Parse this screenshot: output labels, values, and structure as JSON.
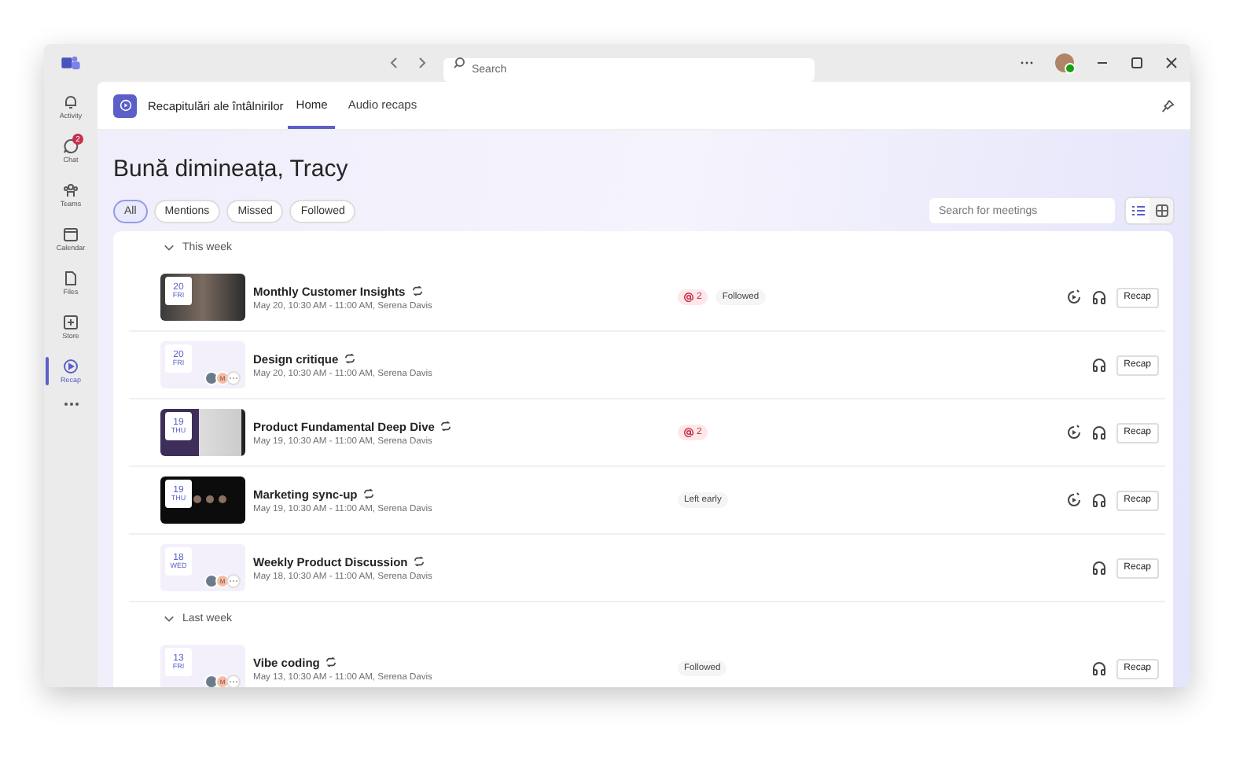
{
  "titlebar": {
    "search_placeholder": "Search"
  },
  "rail": [
    {
      "label": "Activity",
      "kind": "bell",
      "selected": false
    },
    {
      "label": "Chat",
      "kind": "chat",
      "selected": false,
      "badge": "2"
    },
    {
      "label": "Teams",
      "kind": "teams",
      "selected": false
    },
    {
      "label": "Calendar",
      "kind": "calendar",
      "selected": false
    },
    {
      "label": "Files",
      "kind": "file",
      "selected": false
    },
    {
      "label": "Store",
      "kind": "store",
      "selected": false
    },
    {
      "label": "Recap",
      "kind": "recap",
      "selected": true
    }
  ],
  "app": {
    "title": "Recapitulări ale întâlnirilor",
    "tabs": [
      {
        "label": "Home",
        "selected": true
      },
      {
        "label": "Audio recaps",
        "selected": false
      }
    ]
  },
  "greeting": "Bună dimineața, Tracy",
  "filters": [
    {
      "label": "All",
      "selected": true
    },
    {
      "label": "Mentions",
      "selected": false
    },
    {
      "label": "Missed",
      "selected": false
    },
    {
      "label": "Followed",
      "selected": false
    }
  ],
  "meeting_search": {
    "placeholder": "Search for meetings"
  },
  "view_toggle": [
    {
      "kind": "list",
      "selected": true
    },
    {
      "kind": "grid",
      "selected": false
    }
  ],
  "groups": [
    {
      "label": "This week",
      "expanded": true,
      "meetings": [
        {
          "day": "20",
          "weekday": "FRI",
          "kind": "video",
          "title": "Monthly Customer Insights",
          "details": "May 20, 10:30 AM - 11:00 AM, Serena Davis",
          "mentions": "2",
          "tag": "Followed",
          "replay": true,
          "action": "Recap"
        },
        {
          "day": "20",
          "weekday": "FRI",
          "kind": "avatars",
          "avatar_letter": "M",
          "title": "Design critique",
          "details": "May 20, 10:30 AM - 11:00 AM, Serena Davis",
          "replay": false,
          "action": "Recap"
        },
        {
          "day": "19",
          "weekday": "THU",
          "kind": "screen",
          "title": "Product Fundamental Deep Dive",
          "details": "May 19, 10:30 AM - 11:00 AM, Serena Davis",
          "mentions": "2",
          "replay": true,
          "action": "Recap"
        },
        {
          "day": "19",
          "weekday": "THU",
          "kind": "dark",
          "title": "Marketing sync-up",
          "details": "May 19, 10:30 AM - 11:00 AM, Serena Davis",
          "tag": "Left early",
          "replay": true,
          "action": "Recap"
        },
        {
          "day": "18",
          "weekday": "WED",
          "kind": "avatars",
          "avatar_letter": "M",
          "title": "Weekly Product Discussion",
          "details": "May 18, 10:30 AM - 11:00 AM, Serena Davis",
          "replay": false,
          "action": "Recap"
        }
      ]
    },
    {
      "label": "Last week",
      "expanded": true,
      "meetings": [
        {
          "day": "13",
          "weekday": "FRI",
          "kind": "avatars",
          "avatar_letter": "M",
          "title": "Vibe coding",
          "details": "May 13, 10:30 AM - 11:00 AM, Serena Davis",
          "tag": "Followed",
          "replay": false,
          "action": "Recap"
        }
      ]
    }
  ]
}
